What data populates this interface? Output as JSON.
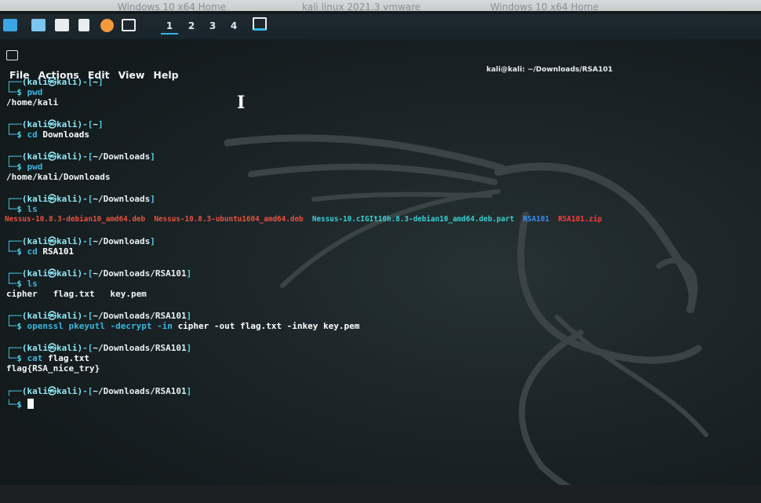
{
  "browser_tabs": [
    "Windows 10 x64 Home",
    "kali linux 2021.3 vmware",
    "Windows 10 x64 Home"
  ],
  "taskbar": {
    "workspaces": [
      "1",
      "2",
      "3",
      "4"
    ],
    "active_workspace": "1"
  },
  "terminal": {
    "window_title": "kali@kali: ~/Downloads/RSA101",
    "menu": [
      "File",
      "Actions",
      "Edit",
      "View",
      "Help"
    ],
    "prompt_user": "(kali㉿kali)",
    "blocks": [
      {
        "path": "~",
        "cmd": "pwd",
        "args": "",
        "output": "/home/kali"
      },
      {
        "path": "~",
        "cmd": "cd",
        "args": "Downloads",
        "output": ""
      },
      {
        "path": "~/Downloads",
        "cmd": "pwd",
        "args": "",
        "output": "/home/kali/Downloads"
      },
      {
        "path": "~/Downloads",
        "cmd": "ls",
        "args": "",
        "output": ""
      },
      {
        "path": "~/Downloads",
        "cmd": "cd",
        "args": "RSA101",
        "output": ""
      },
      {
        "path": "~/Downloads/RSA101",
        "cmd": "ls",
        "args": "",
        "output": "cipher   flag.txt   key.pem"
      },
      {
        "path": "~/Downloads/RSA101",
        "cmd": "openssl pkeyutl -decrypt -in",
        "args": "cipher -out flag.txt -inkey key.pem",
        "output": ""
      },
      {
        "path": "~/Downloads/RSA101",
        "cmd": "cat",
        "args": "flag.txt",
        "output": "flag{RSA_nice_try}"
      },
      {
        "path": "~/Downloads/RSA101",
        "cmd": "",
        "args": "",
        "output": ""
      }
    ],
    "ls_downloads": [
      {
        "name": "Nessus-10.8.3-debian10_amd64.deb",
        "kind": "deb"
      },
      {
        "name": "Nessus-10.8.3-ubuntu1604_amd64.deb",
        "kind": "deb"
      },
      {
        "name": "Nessus-10.cIGIt10h.8.3-debian10_amd64.deb.part",
        "kind": "part"
      },
      {
        "name": "RSA101",
        "kind": "dir"
      },
      {
        "name": "RSA101.zip",
        "kind": "zip"
      }
    ]
  },
  "colors": {
    "prompt": "#4fd1e8",
    "deb": "#e8523f",
    "part": "#3ad0d0",
    "directory": "#3b8cf0",
    "zip": "#ff3b3b"
  }
}
